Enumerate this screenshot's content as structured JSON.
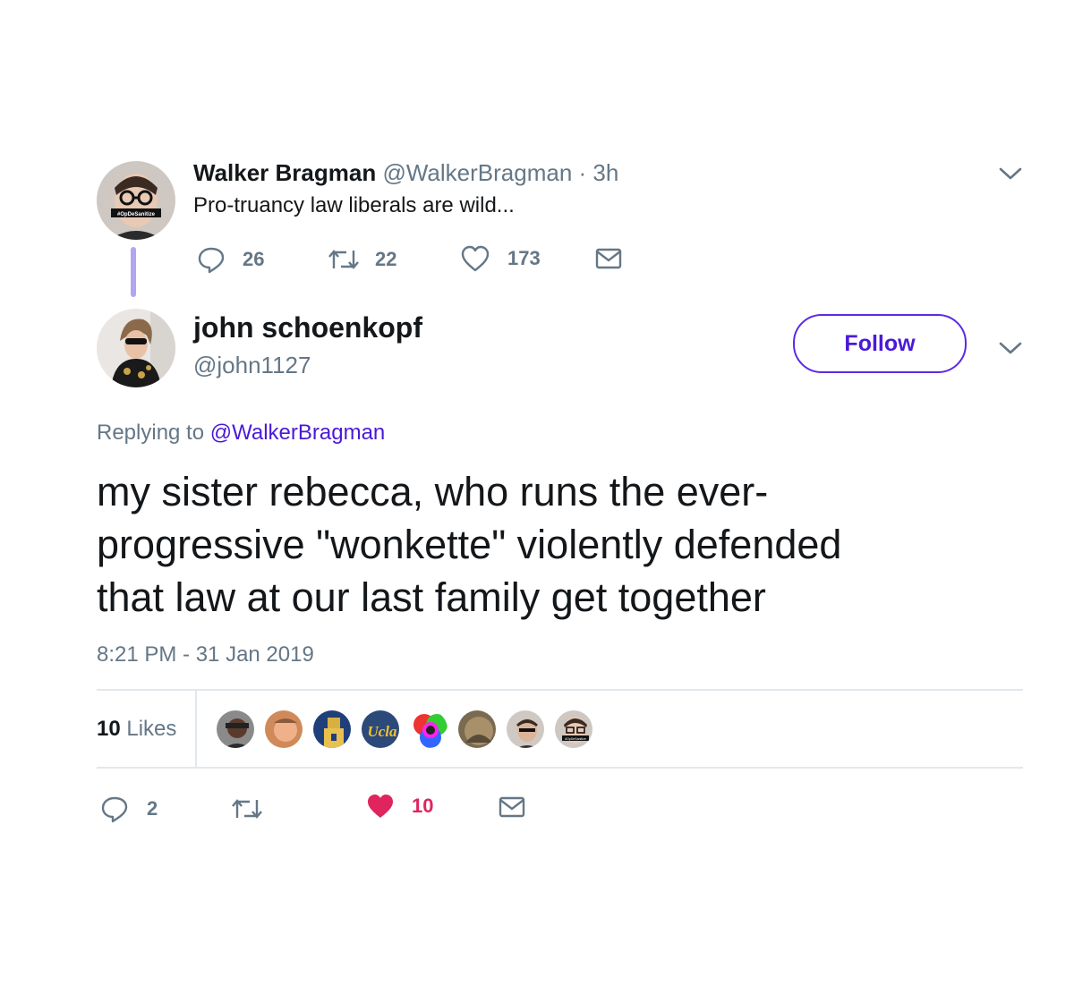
{
  "parent_tweet": {
    "display_name": "Walker Bragman",
    "handle": "@WalkerBragman",
    "separator": "·",
    "time": "3h",
    "text": "Pro-truancy law liberals are wild...",
    "avatar_badge": "#OpDeSanitize",
    "replies": "26",
    "retweets": "22",
    "likes": "173"
  },
  "main_tweet": {
    "display_name": "john schoenkopf",
    "handle": "@john1127",
    "follow_label": "Follow",
    "replying_prefix": "Replying to",
    "replying_to": "@WalkerBragman",
    "text_lines": [
      "my sister rebecca, who runs the ever-",
      "progressive \"wonkette\" violently defended",
      "that law at our last family get together"
    ],
    "timestamp": "8:21 PM - 31 Jan 2019",
    "likes_count": "10",
    "likes_label": "Likes",
    "ucla_label": "Ucla",
    "liker_badge": "#OpDeSanitize",
    "replies": "2",
    "likes": "10"
  },
  "colors": {
    "accent": "#4a19d8",
    "thread_line": "#b3a4f5",
    "like_red": "#e0245e",
    "muted": "#657786"
  }
}
